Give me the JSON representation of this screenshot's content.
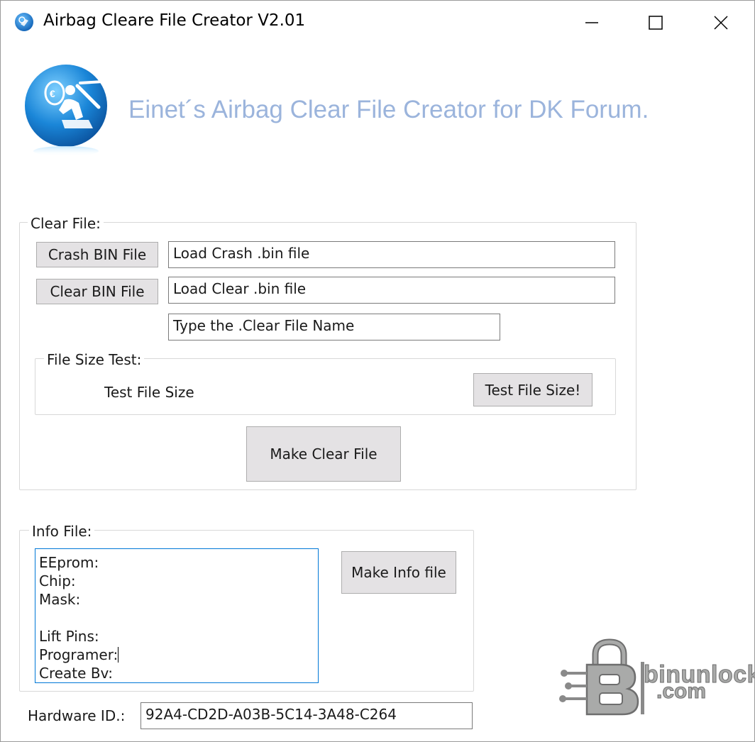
{
  "window": {
    "title": "Airbag Cleare File Creator V2.01"
  },
  "header": {
    "heading": "Einet´s Airbag Clear File Creator for DK Forum."
  },
  "clear_file": {
    "group_label": "Clear File:",
    "crash_bin_button": "Crash BIN File",
    "crash_bin_path": "Load Crash .bin file",
    "clear_bin_button": "Clear BIN File",
    "clear_bin_path": "Load Clear .bin file",
    "clear_file_name": "Type the .Clear File Name",
    "file_size_test": {
      "group_label": "File Size Test:",
      "status_label": "Test File Size",
      "test_button": "Test File Size!"
    },
    "make_button": "Make Clear File"
  },
  "info_file": {
    "group_label": "Info File:",
    "lines": [
      "EEprom:",
      "Chip:",
      "Mask:",
      "",
      "Lift Pins:",
      "Programer:",
      "Create Bv:"
    ],
    "make_button": "Make Info file"
  },
  "hardware": {
    "label": "Hardware ID.:",
    "id": "92A4-CD2D-A03B-5C14-3A48-C264"
  },
  "watermark": {
    "line1": "binunlock",
    "line2": ".com"
  },
  "icons": {
    "app": "airbag-app-icon",
    "logo": "airbag-logo-icon",
    "minimize": "minimize-icon",
    "maximize": "maximize-icon",
    "close": "close-icon",
    "watermark": "binunlock-lock-icon"
  },
  "colors": {
    "heading": "#9bb4dc",
    "button_face": "#e4e2e4",
    "focus_border": "#0078d7",
    "logo_blue": "#1a7fd0"
  }
}
